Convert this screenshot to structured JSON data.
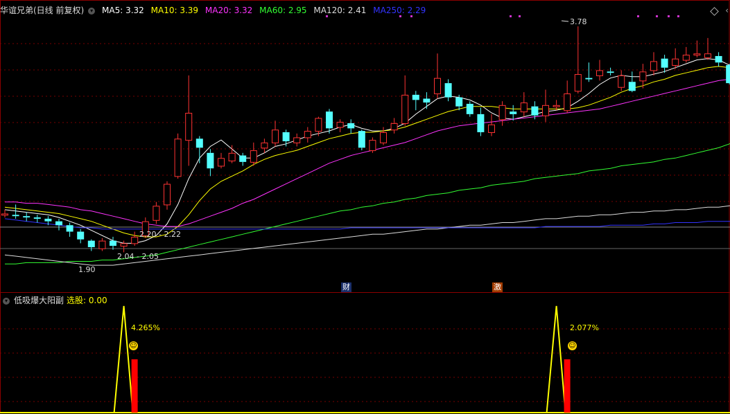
{
  "main": {
    "stock_title": "华谊兄弟(日线 前复权)",
    "ma": [
      {
        "label": "MA5: 3.32",
        "color": "#ffffff"
      },
      {
        "label": "MA10: 3.39",
        "color": "#ffff00"
      },
      {
        "label": "MA20: 3.32",
        "color": "#ff33ff"
      },
      {
        "label": "MA60: 2.95",
        "color": "#33ff33"
      },
      {
        "label": "MA120: 2.41",
        "color": "#dddddd"
      },
      {
        "label": "MA250: 2.29",
        "color": "#3333ff"
      }
    ],
    "price_labels": {
      "high": "3.78",
      "range_upper": "2.20 - 2.22",
      "range_lower": "2.04 - 2.05",
      "low": "1.90"
    },
    "event_tags": [
      {
        "text": "财",
        "color": "#3399ff"
      },
      {
        "text": "激",
        "color": "#ff6600"
      }
    ]
  },
  "indicator": {
    "name": "低吸爆大阳副",
    "select_label": "选股: 0.00",
    "signals": [
      {
        "pct": "4.265%"
      },
      {
        "pct": "2.077%"
      }
    ]
  },
  "chart_data": {
    "type": "candlestick",
    "up_color": "#ff3333",
    "down_color": "#54ffff",
    "candles": [
      [
        2.32,
        2.33,
        2.3,
        2.36
      ],
      [
        2.32,
        2.31,
        2.29,
        2.4
      ],
      [
        2.31,
        2.3,
        2.27,
        2.34
      ],
      [
        2.3,
        2.29,
        2.26,
        2.32
      ],
      [
        2.29,
        2.27,
        2.24,
        2.31
      ],
      [
        2.27,
        2.24,
        2.2,
        2.29
      ],
      [
        2.24,
        2.19,
        2.15,
        2.26
      ],
      [
        2.19,
        2.13,
        2.1,
        2.21
      ],
      [
        2.12,
        2.07,
        2.04,
        2.13
      ],
      [
        2.06,
        2.12,
        2.04,
        2.14
      ],
      [
        2.12,
        2.08,
        2.05,
        2.15
      ],
      [
        2.08,
        2.1,
        2.03,
        2.12
      ],
      [
        2.1,
        2.15,
        2.08,
        2.19
      ],
      [
        2.16,
        2.27,
        2.14,
        2.3
      ],
      [
        2.28,
        2.39,
        2.25,
        2.42
      ],
      [
        2.4,
        2.56,
        2.36,
        2.58
      ],
      [
        2.62,
        2.91,
        2.6,
        2.95
      ],
      [
        2.9,
        3.11,
        2.7,
        3.4
      ],
      [
        2.91,
        2.84,
        2.72,
        2.93
      ],
      [
        2.8,
        2.68,
        2.62,
        2.83
      ],
      [
        2.7,
        2.76,
        2.68,
        2.8
      ],
      [
        2.74,
        2.8,
        2.72,
        2.86
      ],
      [
        2.78,
        2.73,
        2.7,
        2.8
      ],
      [
        2.73,
        2.82,
        2.7,
        2.88
      ],
      [
        2.84,
        2.88,
        2.8,
        2.91
      ],
      [
        2.88,
        2.98,
        2.85,
        3.05
      ],
      [
        2.96,
        2.89,
        2.85,
        2.98
      ],
      [
        2.88,
        2.92,
        2.85,
        2.95
      ],
      [
        2.92,
        2.97,
        2.88,
        3.0
      ],
      [
        2.97,
        3.07,
        2.93,
        3.08
      ],
      [
        3.12,
        2.99,
        2.95,
        3.14
      ],
      [
        3.0,
        3.04,
        2.96,
        3.06
      ],
      [
        3.03,
        2.99,
        2.95,
        3.06
      ],
      [
        2.97,
        2.84,
        2.82,
        2.98
      ],
      [
        2.82,
        2.9,
        2.8,
        2.92
      ],
      [
        2.88,
        2.96,
        2.86,
        3.0
      ],
      [
        2.98,
        3.03,
        2.95,
        3.07
      ],
      [
        3.03,
        3.25,
        3.01,
        3.4
      ],
      [
        3.25,
        3.21,
        3.13,
        3.28
      ],
      [
        3.22,
        3.19,
        3.14,
        3.27
      ],
      [
        3.26,
        3.38,
        3.22,
        3.57
      ],
      [
        3.34,
        3.23,
        3.2,
        3.37
      ],
      [
        3.23,
        3.16,
        3.13,
        3.25
      ],
      [
        3.18,
        3.1,
        3.08,
        3.2
      ],
      [
        3.1,
        2.96,
        2.93,
        3.15
      ],
      [
        2.96,
        3.02,
        2.93,
        3.1
      ],
      [
        3.06,
        3.17,
        3.01,
        3.2
      ],
      [
        3.12,
        3.1,
        3.05,
        3.17
      ],
      [
        3.12,
        3.19,
        3.08,
        3.27
      ],
      [
        3.16,
        3.09,
        3.06,
        3.2
      ],
      [
        3.09,
        3.17,
        3.04,
        3.29
      ],
      [
        3.16,
        3.17,
        3.13,
        3.21
      ],
      [
        3.13,
        3.26,
        3.11,
        3.36
      ],
      [
        3.28,
        3.41,
        3.26,
        3.78
      ],
      [
        3.38,
        3.37,
        3.35,
        3.5
      ],
      [
        3.4,
        3.44,
        3.36,
        3.52
      ],
      [
        3.43,
        3.42,
        3.4,
        3.46
      ],
      [
        3.31,
        3.4,
        3.28,
        3.44
      ],
      [
        3.35,
        3.28,
        3.27,
        3.43
      ],
      [
        3.36,
        3.43,
        3.3,
        3.49
      ],
      [
        3.44,
        3.51,
        3.4,
        3.58
      ],
      [
        3.53,
        3.46,
        3.42,
        3.56
      ],
      [
        3.48,
        3.53,
        3.45,
        3.61
      ],
      [
        3.52,
        3.56,
        3.5,
        3.62
      ],
      [
        3.56,
        3.57,
        3.54,
        3.67
      ],
      [
        3.54,
        3.57,
        3.52,
        3.69
      ],
      [
        3.55,
        3.5,
        3.47,
        3.58
      ],
      [
        3.48,
        3.34,
        3.33,
        3.49
      ],
      [
        3.33,
        3.29,
        3.25,
        3.34
      ],
      [
        3.25,
        3.27,
        3.19,
        3.29
      ]
    ],
    "ma_series": [
      {
        "name": "MA5",
        "color": "#ffffff",
        "values": [
          2.36,
          2.35,
          2.34,
          2.33,
          2.32,
          2.3,
          2.27,
          2.24,
          2.2,
          2.16,
          2.12,
          2.1,
          2.1,
          2.12,
          2.16,
          2.25,
          2.4,
          2.6,
          2.76,
          2.85,
          2.9,
          2.83,
          2.76,
          2.76,
          2.8,
          2.85,
          2.87,
          2.9,
          2.93,
          2.95,
          2.97,
          3.0,
          3.02,
          2.99,
          2.97,
          2.97,
          2.99,
          3.03,
          3.1,
          3.16,
          3.22,
          3.24,
          3.23,
          3.21,
          3.17,
          3.11,
          3.07,
          3.06,
          3.08,
          3.1,
          3.12,
          3.13,
          3.15,
          3.2,
          3.26,
          3.33,
          3.38,
          3.4,
          3.39,
          3.39,
          3.41,
          3.43,
          3.46,
          3.49,
          3.52,
          3.53,
          3.52,
          3.48,
          3.41,
          3.32
        ]
      },
      {
        "name": "MA10",
        "color": "#ffff00",
        "values": [
          2.38,
          2.37,
          2.36,
          2.35,
          2.34,
          2.33,
          2.31,
          2.29,
          2.27,
          2.24,
          2.21,
          2.18,
          2.16,
          2.15,
          2.15,
          2.17,
          2.23,
          2.32,
          2.43,
          2.52,
          2.58,
          2.62,
          2.66,
          2.71,
          2.75,
          2.78,
          2.8,
          2.82,
          2.85,
          2.88,
          2.91,
          2.93,
          2.95,
          2.96,
          2.96,
          2.97,
          2.98,
          3.0,
          3.03,
          3.06,
          3.09,
          3.12,
          3.14,
          3.16,
          3.16,
          3.16,
          3.15,
          3.14,
          3.14,
          3.14,
          3.14,
          3.14,
          3.14,
          3.15,
          3.17,
          3.2,
          3.23,
          3.27,
          3.3,
          3.32,
          3.35,
          3.37,
          3.4,
          3.42,
          3.44,
          3.46,
          3.47,
          3.46,
          3.43,
          3.39
        ]
      },
      {
        "name": "MA20",
        "color": "#ff33ff",
        "values": [
          2.42,
          2.42,
          2.41,
          2.41,
          2.4,
          2.39,
          2.38,
          2.36,
          2.35,
          2.33,
          2.31,
          2.29,
          2.27,
          2.25,
          2.24,
          2.23,
          2.23,
          2.25,
          2.28,
          2.31,
          2.34,
          2.37,
          2.41,
          2.44,
          2.48,
          2.52,
          2.56,
          2.6,
          2.64,
          2.68,
          2.72,
          2.75,
          2.78,
          2.8,
          2.82,
          2.84,
          2.86,
          2.88,
          2.91,
          2.94,
          2.97,
          2.99,
          3.01,
          3.02,
          3.03,
          3.04,
          3.05,
          3.06,
          3.07,
          3.08,
          3.09,
          3.1,
          3.11,
          3.12,
          3.13,
          3.14,
          3.16,
          3.18,
          3.2,
          3.22,
          3.24,
          3.26,
          3.28,
          3.3,
          3.32,
          3.34,
          3.36,
          3.37,
          3.36,
          3.32
        ]
      },
      {
        "name": "MA60",
        "color": "#33ff33",
        "values": [
          1.94,
          1.94,
          1.95,
          1.95,
          1.95,
          1.95,
          1.96,
          1.96,
          1.96,
          1.97,
          1.97,
          1.98,
          1.99,
          2.0,
          2.01,
          2.03,
          2.05,
          2.07,
          2.09,
          2.11,
          2.13,
          2.15,
          2.17,
          2.19,
          2.21,
          2.23,
          2.25,
          2.27,
          2.29,
          2.31,
          2.33,
          2.35,
          2.36,
          2.38,
          2.39,
          2.41,
          2.42,
          2.44,
          2.45,
          2.47,
          2.48,
          2.49,
          2.51,
          2.52,
          2.53,
          2.55,
          2.56,
          2.57,
          2.58,
          2.6,
          2.61,
          2.62,
          2.63,
          2.64,
          2.66,
          2.67,
          2.68,
          2.7,
          2.71,
          2.72,
          2.73,
          2.75,
          2.76,
          2.78,
          2.8,
          2.82,
          2.84,
          2.87,
          2.91,
          2.95
        ]
      },
      {
        "name": "MA120",
        "color": "#dddddd",
        "values": [
          2.01,
          2.0,
          1.99,
          1.98,
          1.97,
          1.96,
          1.95,
          1.94,
          1.93,
          1.93,
          1.93,
          1.94,
          1.95,
          1.96,
          1.97,
          1.98,
          1.99,
          2.0,
          2.01,
          2.02,
          2.03,
          2.04,
          2.05,
          2.06,
          2.07,
          2.08,
          2.09,
          2.1,
          2.11,
          2.12,
          2.13,
          2.14,
          2.15,
          2.16,
          2.17,
          2.17,
          2.18,
          2.19,
          2.2,
          2.21,
          2.21,
          2.22,
          2.23,
          2.24,
          2.24,
          2.25,
          2.26,
          2.26,
          2.27,
          2.28,
          2.29,
          2.29,
          2.3,
          2.31,
          2.31,
          2.32,
          2.32,
          2.33,
          2.34,
          2.34,
          2.35,
          2.35,
          2.36,
          2.36,
          2.37,
          2.38,
          2.38,
          2.39,
          2.4,
          2.41
        ]
      },
      {
        "name": "MA250",
        "color": "#3333ff",
        "values": [
          2.29,
          2.28,
          2.27,
          2.26,
          2.25,
          2.24,
          2.23,
          2.22,
          2.22,
          2.21,
          2.21,
          2.21,
          2.21,
          2.21,
          2.21,
          2.21,
          2.21,
          2.21,
          2.21,
          2.21,
          2.21,
          2.21,
          2.21,
          2.21,
          2.21,
          2.21,
          2.21,
          2.21,
          2.21,
          2.21,
          2.21,
          2.21,
          2.22,
          2.22,
          2.22,
          2.22,
          2.22,
          2.22,
          2.22,
          2.22,
          2.22,
          2.22,
          2.22,
          2.22,
          2.22,
          2.22,
          2.22,
          2.22,
          2.22,
          2.22,
          2.23,
          2.23,
          2.23,
          2.23,
          2.23,
          2.23,
          2.24,
          2.24,
          2.24,
          2.24,
          2.25,
          2.25,
          2.26,
          2.26,
          2.26,
          2.27,
          2.27,
          2.27,
          2.28,
          2.29
        ]
      }
    ],
    "ylim": [
      1.85,
      3.85
    ],
    "indicator_peaks": [
      {
        "index": 11,
        "value": 4.265
      },
      {
        "index": 51,
        "value": 2.077
      }
    ]
  }
}
